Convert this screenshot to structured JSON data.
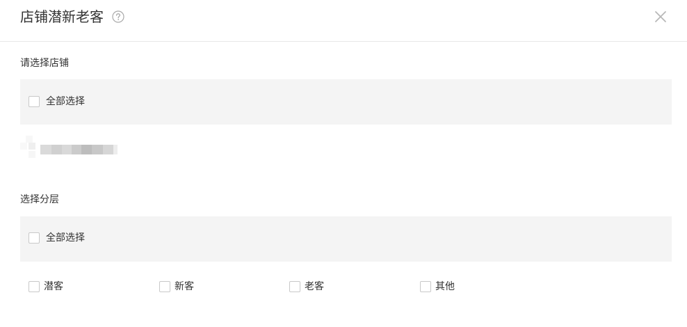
{
  "dialog": {
    "title": "店铺潜新老客",
    "help_icon": "question-circle-icon",
    "close_icon": "close-icon"
  },
  "store_section": {
    "label": "请选择店铺",
    "select_all_label": "全部选择"
  },
  "layer_section": {
    "label": "选择分层",
    "select_all_label": "全部选择",
    "options": [
      {
        "label": "潜客"
      },
      {
        "label": "新客"
      },
      {
        "label": "老客"
      },
      {
        "label": "其他"
      }
    ]
  },
  "colors": {
    "bar_background": "#f4f4f4",
    "divider": "#e8e8e8",
    "checkbox_border": "#c8c8c8",
    "text": "#333333",
    "icon": "#b5b5b5"
  }
}
